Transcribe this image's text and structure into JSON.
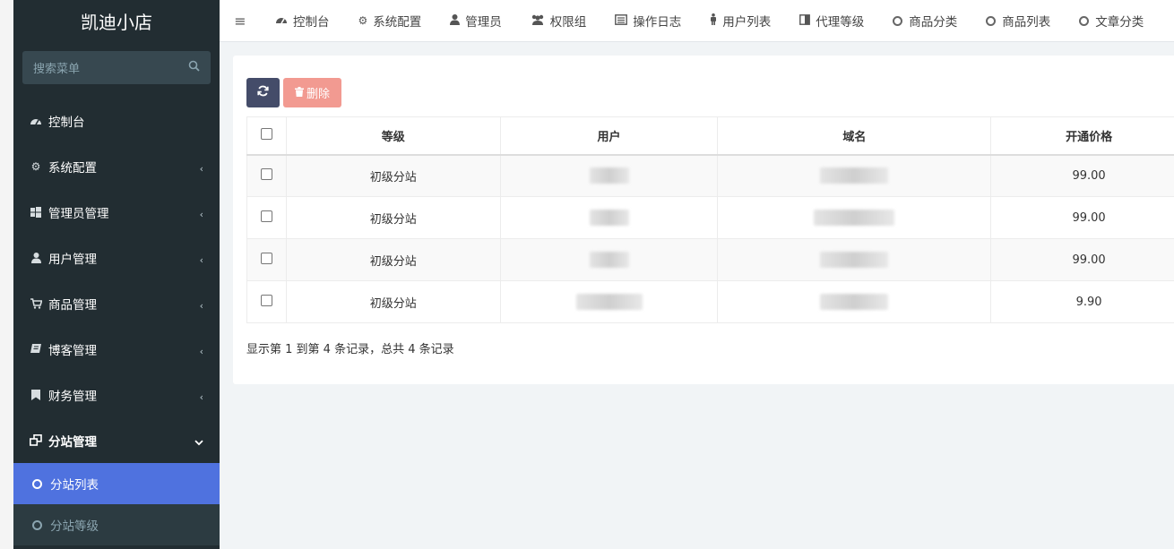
{
  "app": {
    "title": "凯迪小店"
  },
  "search": {
    "placeholder": "搜索菜单"
  },
  "sidebar": {
    "items": [
      {
        "label": "控制台",
        "icon": "dashboard-icon",
        "chevron": false
      },
      {
        "label": "系统配置",
        "icon": "cogs-icon",
        "chevron": true
      },
      {
        "label": "管理员管理",
        "icon": "windows-icon",
        "chevron": true
      },
      {
        "label": "用户管理",
        "icon": "user-icon",
        "chevron": true
      },
      {
        "label": "商品管理",
        "icon": "cart-icon",
        "chevron": true
      },
      {
        "label": "博客管理",
        "icon": "book-icon",
        "chevron": true
      },
      {
        "label": "财务管理",
        "icon": "bookmark-icon",
        "chevron": true
      },
      {
        "label": "分站管理",
        "icon": "clone-icon",
        "chevron": true,
        "open": true
      }
    ],
    "subitems": [
      {
        "label": "分站列表",
        "active": true
      },
      {
        "label": "分站等级",
        "active": false
      }
    ]
  },
  "topnav": {
    "tabs": [
      {
        "label": "控制台",
        "icon": "dashboard-icon"
      },
      {
        "label": "系统配置",
        "icon": "cog-icon"
      },
      {
        "label": "管理员",
        "icon": "user-icon"
      },
      {
        "label": "权限组",
        "icon": "group-icon"
      },
      {
        "label": "操作日志",
        "icon": "list-icon"
      },
      {
        "label": "用户列表",
        "icon": "male-icon"
      },
      {
        "label": "代理等级",
        "icon": "columns-icon"
      },
      {
        "label": "商品分类",
        "icon": "circle-icon"
      },
      {
        "label": "商品列表",
        "icon": "circle-icon"
      },
      {
        "label": "文章分类",
        "icon": "circle-icon"
      }
    ]
  },
  "toolbar": {
    "delete_label": "删除"
  },
  "table": {
    "headers": [
      "等级",
      "用户",
      "域名",
      "开通价格"
    ],
    "rows": [
      {
        "level": "初级分站",
        "price": "99.00"
      },
      {
        "level": "初级分站",
        "price": "99.00"
      },
      {
        "level": "初级分站",
        "price": "99.00"
      },
      {
        "level": "初级分站",
        "price": "9.90"
      }
    ]
  },
  "pager": {
    "summary": "显示第 1 到第 4 条记录，总共 4 条记录"
  },
  "colors": {
    "sidebar_bg": "#222d32",
    "active_item": "#4f72df",
    "refresh_btn": "#444c69",
    "delete_btn": "#f29a91"
  }
}
